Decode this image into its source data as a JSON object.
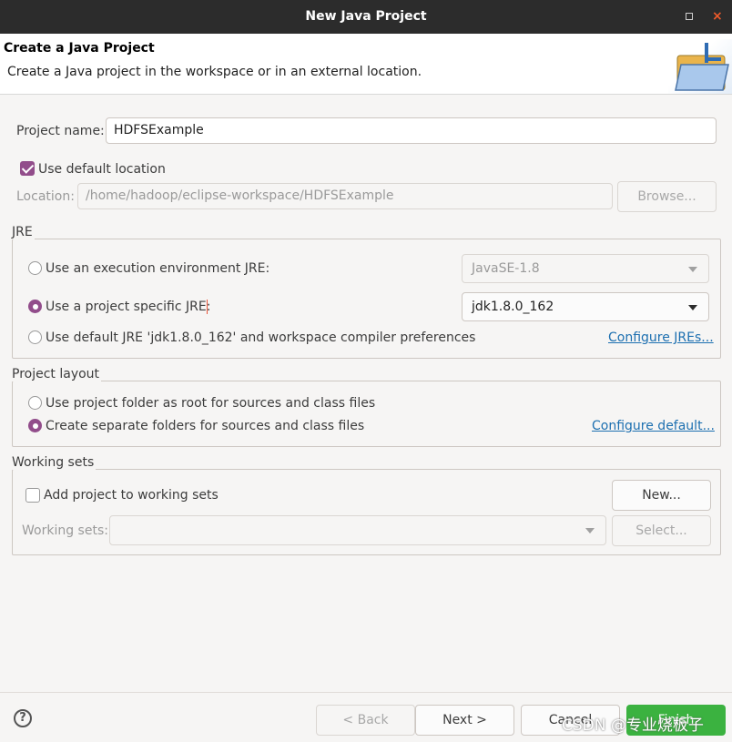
{
  "window": {
    "title": "New Java Project"
  },
  "header": {
    "title": "Create a Java Project",
    "subtitle": "Create a Java project in the workspace or in an external location.",
    "icon": "new-folder-wizard-icon"
  },
  "project": {
    "name_label": "Project name:",
    "name_value": "HDFSExample",
    "use_default_location_label": "Use default location",
    "use_default_location_checked": true,
    "location_label": "Location:",
    "location_value": "/home/hadoop/eclipse-workspace/HDFSExample",
    "browse_label": "Browse..."
  },
  "jre": {
    "group_title": "JRE",
    "options": [
      {
        "label": "Use an execution environment JRE:",
        "selected": false
      },
      {
        "label": "Use a project specific JRE:",
        "selected": true
      },
      {
        "label": "Use default JRE 'jdk1.8.0_162' and workspace compiler preferences",
        "selected": false
      }
    ],
    "env_combo_value": "JavaSE-1.8",
    "project_jre_value": "jdk1.8.0_162",
    "configure_link": "Configure JREs..."
  },
  "layout": {
    "group_title": "Project layout",
    "options": [
      {
        "label": "Use project folder as root for sources and class files",
        "selected": false
      },
      {
        "label": "Create separate folders for sources and class files",
        "selected": true
      }
    ],
    "configure_link": "Configure default..."
  },
  "working_sets": {
    "group_title": "Working sets",
    "add_label": "Add project to working sets",
    "add_checked": false,
    "new_label": "New...",
    "sets_label": "Working sets:",
    "sets_value": "",
    "select_label": "Select..."
  },
  "footer": {
    "help": "?",
    "back": "< Back",
    "next": "Next >",
    "cancel": "Cancel",
    "finish": "Finish"
  },
  "watermark": "CSDN @专业烧板子",
  "colors": {
    "accent": "#924d8b",
    "link": "#1c6fb0",
    "finish": "#3bb240",
    "titlebar": "#2c2c2c"
  }
}
